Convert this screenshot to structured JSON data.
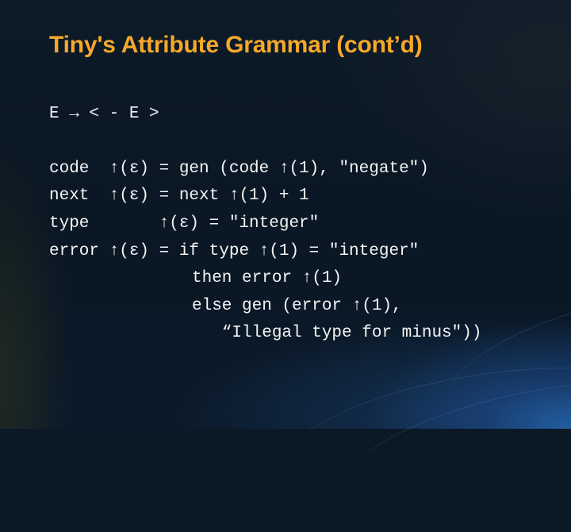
{
  "slide": {
    "title": "Tiny's Attribute Grammar (cont’d)",
    "colors": {
      "title": "#f6a82a",
      "text": "#f4f4f4",
      "background": "#0b1826"
    },
    "production": "E → < - E >",
    "rules": [
      {
        "attribute": "code",
        "line": "code  ↑(ε) = gen (code ↑(1), \"negate\")"
      },
      {
        "attribute": "next",
        "line": "next  ↑(ε) = next ↑(1) + 1"
      },
      {
        "attribute": "type",
        "line": "type       ↑(ε) = \"integer\""
      },
      {
        "attribute": "error",
        "line": "error ↑(ε) = if type ↑(1) = \"integer\""
      }
    ],
    "continuation": [
      "then error ↑(1)",
      "else gen (error ↑(1),",
      "   “Illegal type for minus\"))"
    ]
  }
}
